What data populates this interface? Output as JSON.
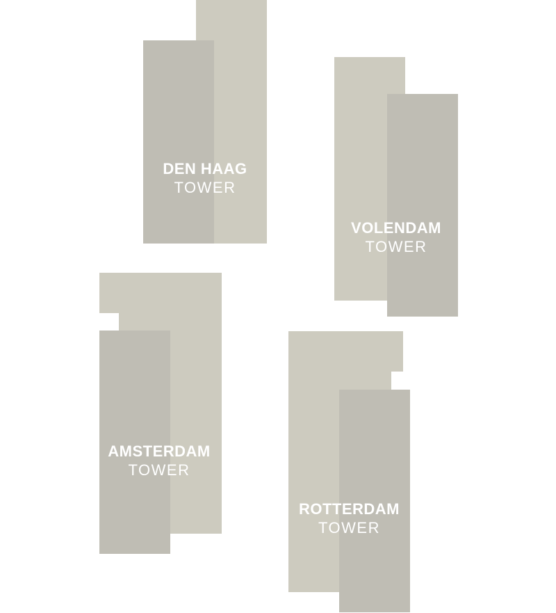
{
  "towers": [
    {
      "name": "DEN HAAG",
      "subtitle": "TOWER"
    },
    {
      "name": "VOLENDAM",
      "subtitle": "TOWER"
    },
    {
      "name": "AMSTERDAM",
      "subtitle": "TOWER"
    },
    {
      "name": "ROTTERDAM",
      "subtitle": "TOWER"
    }
  ],
  "colors": {
    "light_block": "#cdcbbf",
    "dark_block": "#bfbdb4",
    "label_text": "#ffffff",
    "background": "#ffffff"
  }
}
